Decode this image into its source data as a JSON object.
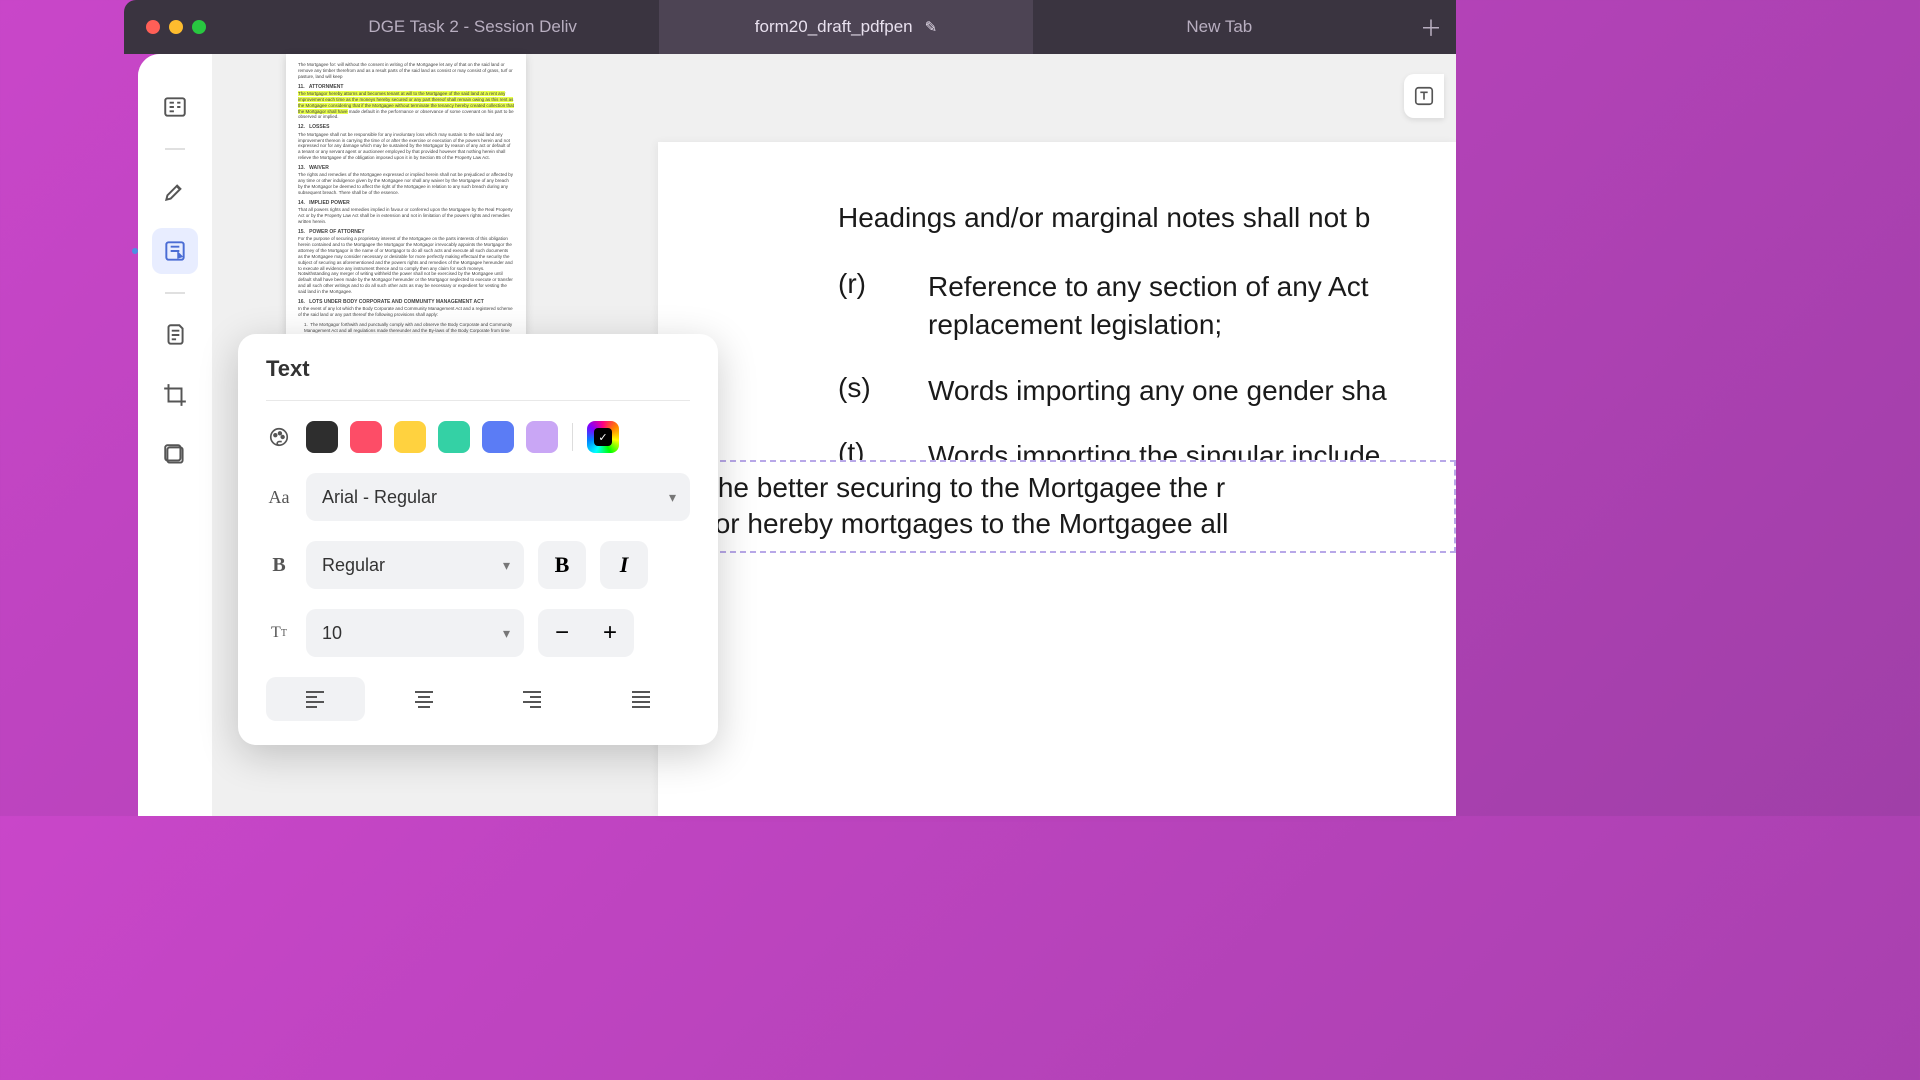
{
  "tabs": [
    {
      "label": "DGE Task 2 - Session Deliv"
    },
    {
      "label": "form20_draft_pdfpen"
    },
    {
      "label": "New Tab"
    }
  ],
  "text_panel": {
    "title": "Text",
    "colors": {
      "black": "#2e2e2e",
      "pink": "#fd4d67",
      "yellow": "#ffd23f",
      "teal": "#34d1a5",
      "blue": "#5b7cf5",
      "purple": "#c9a6f5"
    },
    "font_family": "Arial - Regular",
    "font_weight": "Regular",
    "font_size": "10"
  },
  "document": {
    "heading": "Headings and/or marginal notes shall not b",
    "clauses": [
      {
        "letter": "(r)",
        "text": "Reference to any section of any Act \nreplacement legislation;"
      },
      {
        "letter": "(s)",
        "text": "Words importing any one gender sha"
      },
      {
        "letter": "(t)",
        "text": "Words importing the singular include"
      }
    ],
    "textbox": "And for the better securing to the Mortgagee the r\nMortgagor hereby mortgages to the Mortgagee all"
  }
}
